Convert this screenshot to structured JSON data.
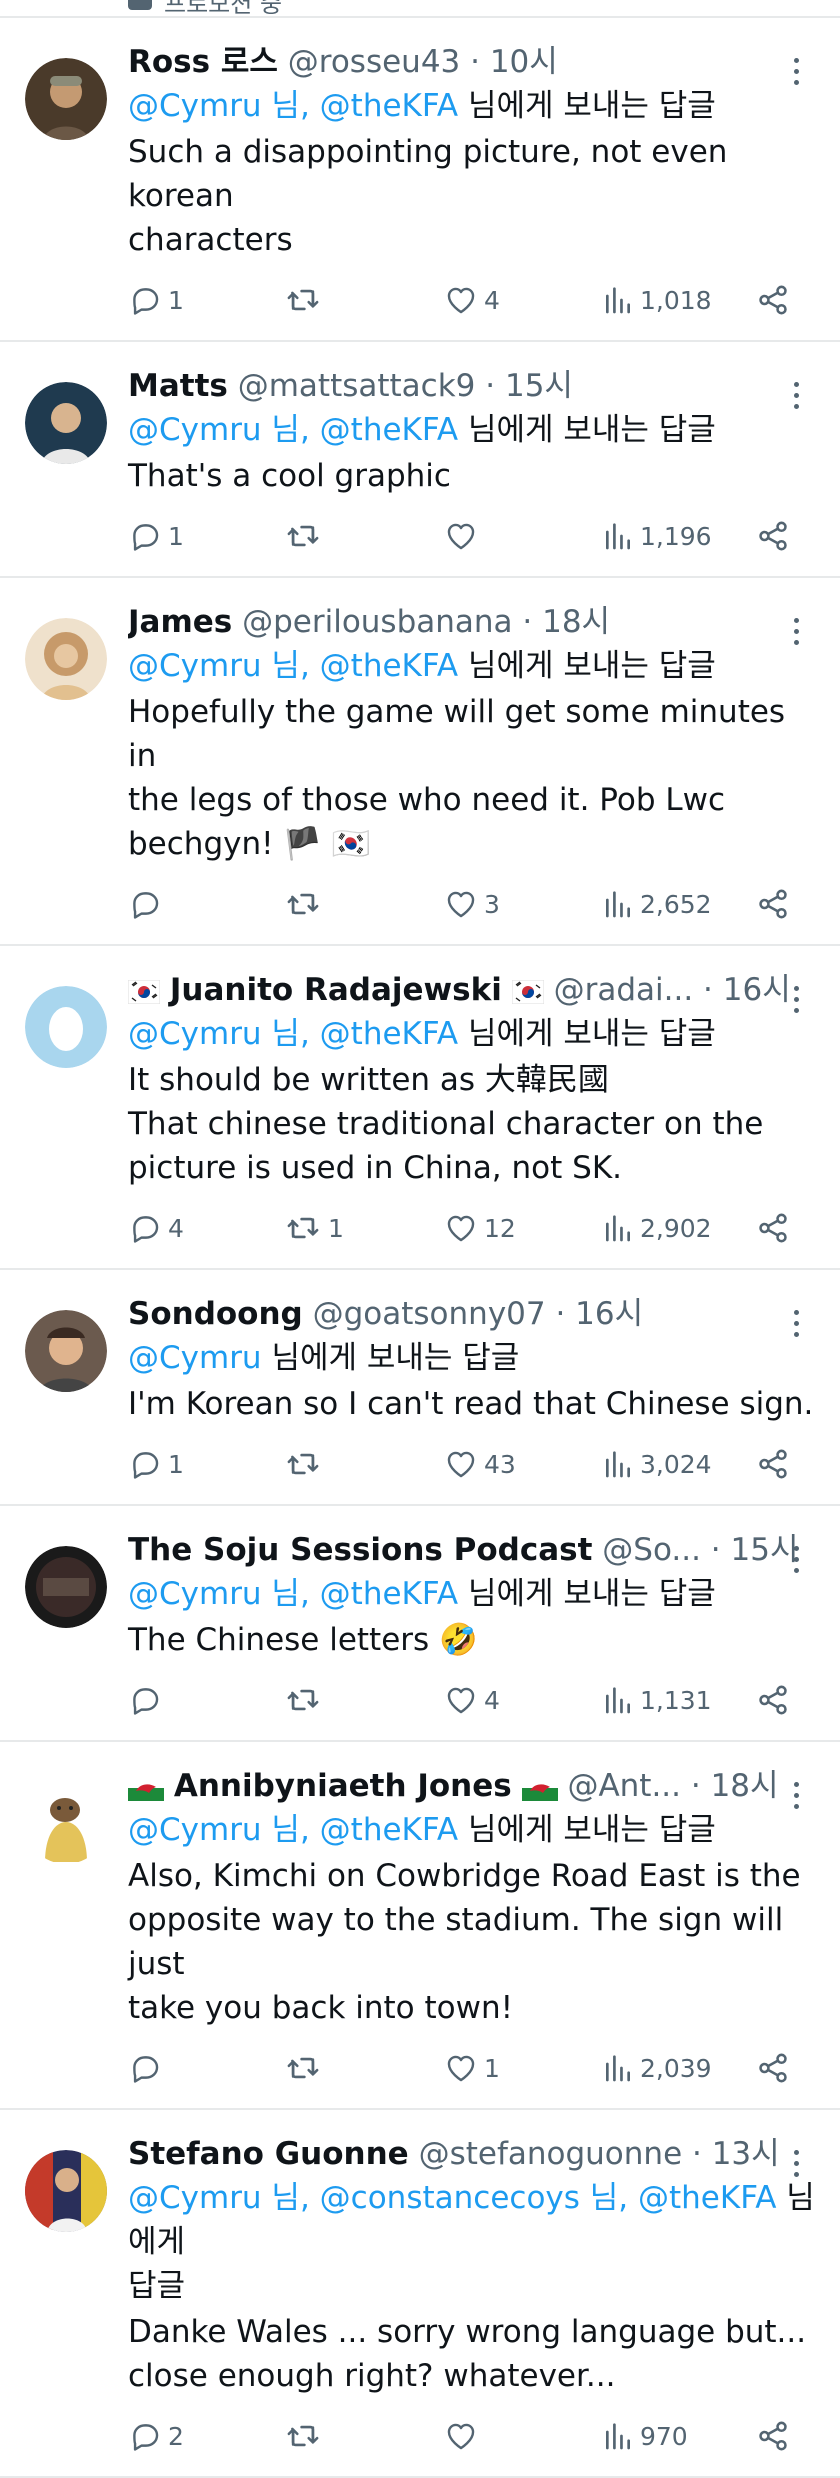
{
  "top_partial_text": "프로모션 중",
  "tweets": [
    {
      "name": "Ross 로스",
      "handle": "@rosseu43",
      "time": "10시",
      "reply_prefix": "",
      "mentions": [
        "@Cymru 님,",
        "@theKFA"
      ],
      "reply_suffix": "님에게 보내는 답글",
      "lines": [
        "Such a disappointing picture, not even korean",
        "characters"
      ],
      "replies": "1",
      "retweets": "",
      "likes": "4",
      "views": "1,018",
      "avatar_color": "#4a3a2a"
    },
    {
      "name": "Matts",
      "handle": "@mattsattack9",
      "time": "15시",
      "mentions": [
        "@Cymru 님,",
        "@theKFA"
      ],
      "reply_suffix": "님에게 보내는 답글",
      "lines": [
        "That's a cool graphic"
      ],
      "replies": "1",
      "retweets": "",
      "likes": "",
      "views": "1,196",
      "avatar_color": "#1f3a4f"
    },
    {
      "name": "James",
      "handle": "@perilousbanana",
      "time": "18시",
      "mentions": [
        "@Cymru 님,",
        "@theKFA"
      ],
      "reply_suffix": "님에게 보내는 답글",
      "lines": [
        "Hopefully the game will get some minutes in",
        "the legs of those who need it. Pob Lwc",
        "bechgyn! 🏴 🇰🇷"
      ],
      "replies": "",
      "retweets": "",
      "likes": "3",
      "views": "2,652",
      "avatar_color": "#c79a6a"
    },
    {
      "name": "Juanito Radajewski",
      "handle": "@radai...",
      "time": "16시",
      "mentions": [
        "@Cymru 님,",
        "@theKFA"
      ],
      "reply_suffix": "님에게 보내는 답글",
      "lines": [
        "It should be written as 大韓民國",
        "That chinese traditional character on the",
        "picture is used in China, not SK."
      ],
      "replies": "4",
      "retweets": "1",
      "likes": "12",
      "views": "2,902",
      "avatar_color": "#a9d6ee"
    },
    {
      "name": "Sondoong",
      "handle": "@goatsonny07",
      "time": "16시",
      "mentions": [
        "@Cymru"
      ],
      "reply_suffix": "님에게 보내는 답글",
      "lines": [
        "I'm Korean so I can't read that Chinese sign."
      ],
      "replies": "1",
      "retweets": "",
      "likes": "43",
      "views": "3,024",
      "avatar_color": "#3a2a22"
    },
    {
      "name": "The Soju Sessions Podcast",
      "handle": "@So...",
      "time": "15시",
      "mentions": [
        "@Cymru 님,",
        "@theKFA"
      ],
      "reply_suffix": "님에게 보내는 답글",
      "lines": [
        "The Chinese letters 🤣"
      ],
      "replies": "",
      "retweets": "",
      "likes": "4",
      "views": "1,131",
      "avatar_color": "#1a1a1a"
    },
    {
      "name": "Annibyniaeth Jones",
      "handle": "@Ant...",
      "time": "18시",
      "mentions": [
        "@Cymru 님,",
        "@theKFA"
      ],
      "reply_suffix": "님에게 보내는 답글",
      "lines": [
        "Also, Kimchi on Cowbridge Road East is the",
        "opposite way to the stadium. The sign will just",
        "take you back into town!"
      ],
      "replies": "",
      "retweets": "",
      "likes": "1",
      "views": "2,039",
      "avatar_color": "#e8e2d2"
    },
    {
      "name": "Stefano Guonne",
      "handle": "@stefanoguonne",
      "time": "13시",
      "mentions": [
        "@Cymru 님,",
        "@constancecoys 님,",
        "@theKFA"
      ],
      "reply_suffix": "님에게",
      "reply_second_line": "답글",
      "lines": [
        "Danke Wales ... sorry wrong language but...",
        "close enough right?  whatever..."
      ],
      "replies": "2",
      "retweets": "",
      "likes": "",
      "views": "970",
      "avatar_color": "#2a2f5a"
    }
  ]
}
